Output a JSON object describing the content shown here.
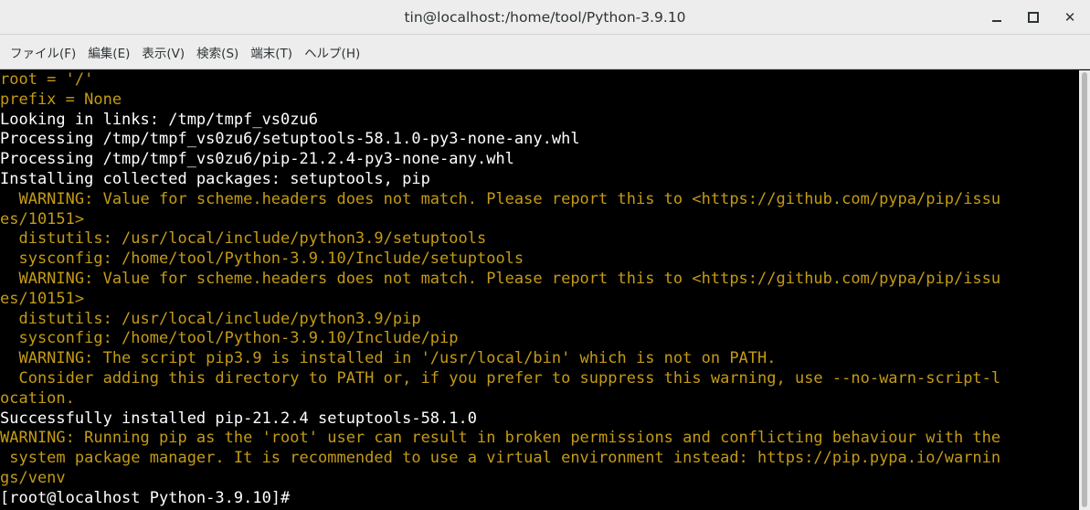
{
  "window": {
    "title": "tin@localhost:/home/tool/Python-3.9.10"
  },
  "menu": [
    "ファイル(F)",
    "編集(E)",
    "表示(V)",
    "検索(S)",
    "端末(T)",
    "ヘルプ(H)"
  ],
  "colors": {
    "terminal_bg": "#000000",
    "text_white": "#ffffff",
    "text_warning": "#c49b15"
  },
  "terminal": {
    "lines": [
      {
        "text": "root = '/'",
        "style": "orange"
      },
      {
        "text": "prefix = None",
        "style": "orange"
      },
      {
        "text": "Looking in links: /tmp/tmpf_vs0zu6",
        "style": "white"
      },
      {
        "text": "Processing /tmp/tmpf_vs0zu6/setuptools-58.1.0-py3-none-any.whl",
        "style": "white"
      },
      {
        "text": "Processing /tmp/tmpf_vs0zu6/pip-21.2.4-py3-none-any.whl",
        "style": "white"
      },
      {
        "text": "Installing collected packages: setuptools, pip",
        "style": "white"
      },
      {
        "text": "  WARNING: Value for scheme.headers does not match. Please report this to <https://github.com/pypa/pip/issu",
        "style": "orange"
      },
      {
        "text": "es/10151>",
        "style": "orange"
      },
      {
        "text": "  distutils: /usr/local/include/python3.9/setuptools",
        "style": "orange"
      },
      {
        "text": "  sysconfig: /home/tool/Python-3.9.10/Include/setuptools",
        "style": "orange"
      },
      {
        "text": "  WARNING: Value for scheme.headers does not match. Please report this to <https://github.com/pypa/pip/issu",
        "style": "orange"
      },
      {
        "text": "es/10151>",
        "style": "orange"
      },
      {
        "text": "  distutils: /usr/local/include/python3.9/pip",
        "style": "orange"
      },
      {
        "text": "  sysconfig: /home/tool/Python-3.9.10/Include/pip",
        "style": "orange"
      },
      {
        "text": "  WARNING: The script pip3.9 is installed in '/usr/local/bin' which is not on PATH.",
        "style": "orange"
      },
      {
        "text": "  Consider adding this directory to PATH or, if you prefer to suppress this warning, use --no-warn-script-l",
        "style": "orange"
      },
      {
        "text": "ocation.",
        "style": "orange"
      },
      {
        "text": "Successfully installed pip-21.2.4 setuptools-58.1.0",
        "style": "white"
      },
      {
        "text": "WARNING: Running pip as the 'root' user can result in broken permissions and conflicting behaviour with the",
        "style": "orange"
      },
      {
        "text": " system package manager. It is recommended to use a virtual environment instead: https://pip.pypa.io/warnin",
        "style": "orange"
      },
      {
        "text": "gs/venv",
        "style": "orange"
      },
      {
        "text": "[root@localhost Python-3.9.10]# ",
        "style": "white"
      }
    ]
  }
}
